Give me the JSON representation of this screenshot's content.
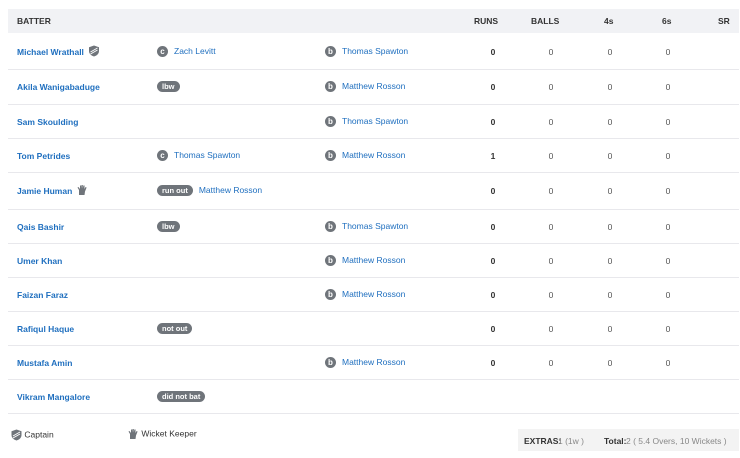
{
  "columns": {
    "batter": "BATTER",
    "runs": "RUNS",
    "balls": "BALLS",
    "fours": "4s",
    "sixes": "6s",
    "sr": "SR"
  },
  "rows": [
    {
      "name": "Michael Wrathall",
      "role": "captain",
      "dismissal_type": "c",
      "fielder": "Zach Levitt",
      "bowler_mark": "b",
      "bowler": "Thomas Spawton",
      "runs": "0",
      "balls": "0",
      "fours": "0",
      "sixes": "0"
    },
    {
      "name": "Akila Wanigabaduge",
      "dismissal_type": "lbw",
      "fielder": "",
      "bowler_mark": "b",
      "bowler": "Matthew Rosson",
      "runs": "0",
      "balls": "0",
      "fours": "0",
      "sixes": "0"
    },
    {
      "name": "Sam Skoulding",
      "dismissal_type": "",
      "fielder": "",
      "bowler_mark": "b",
      "bowler": "Thomas Spawton",
      "runs": "0",
      "balls": "0",
      "fours": "0",
      "sixes": "0"
    },
    {
      "name": "Tom Petrides",
      "dismissal_type": "c",
      "fielder": "Thomas Spawton",
      "bowler_mark": "b",
      "bowler": "Matthew Rosson",
      "runs": "1",
      "balls": "0",
      "fours": "0",
      "sixes": "0"
    },
    {
      "name": "Jamie Human",
      "role": "keeper",
      "dismissal_type": "run out",
      "fielder": "Matthew Rosson",
      "bowler_mark": "",
      "bowler": "",
      "runs": "0",
      "balls": "0",
      "fours": "0",
      "sixes": "0"
    },
    {
      "name": "Qais Bashir",
      "dismissal_type": "lbw",
      "fielder": "",
      "bowler_mark": "b",
      "bowler": "Thomas Spawton",
      "runs": "0",
      "balls": "0",
      "fours": "0",
      "sixes": "0"
    },
    {
      "name": "Umer Khan",
      "dismissal_type": "",
      "fielder": "",
      "bowler_mark": "b",
      "bowler": "Matthew Rosson",
      "runs": "0",
      "balls": "0",
      "fours": "0",
      "sixes": "0"
    },
    {
      "name": "Faizan Faraz",
      "dismissal_type": "",
      "fielder": "",
      "bowler_mark": "b",
      "bowler": "Matthew Rosson",
      "runs": "0",
      "balls": "0",
      "fours": "0",
      "sixes": "0"
    },
    {
      "name": "Rafiqul Haque",
      "dismissal_type": "not out",
      "fielder": "",
      "bowler_mark": "",
      "bowler": "",
      "runs": "0",
      "balls": "0",
      "fours": "0",
      "sixes": "0"
    },
    {
      "name": "Mustafa Amin",
      "dismissal_type": "",
      "fielder": "",
      "bowler_mark": "b",
      "bowler": "Matthew Rosson",
      "runs": "0",
      "balls": "0",
      "fours": "0",
      "sixes": "0"
    },
    {
      "name": "Vikram Mangalore",
      "dismissal_type": "did not bat",
      "fielder": "",
      "bowler_mark": "",
      "bowler": "",
      "runs": "",
      "balls": "",
      "fours": "",
      "sixes": ""
    }
  ],
  "legend": {
    "captain": "Captain",
    "keeper": "Wicket Keeper"
  },
  "extras": {
    "label": "EXTRAS:",
    "value": "1 (1w )",
    "total_label": "Total:",
    "total_value": "2 ( 5.4 Overs, 10 Wickets )"
  },
  "icons": {
    "captain": "shield-icon",
    "keeper": "glove-icon"
  },
  "colors": {
    "link": "#1f6fbf",
    "badge": "#6f747a",
    "header_bg": "#f1f2f5"
  }
}
